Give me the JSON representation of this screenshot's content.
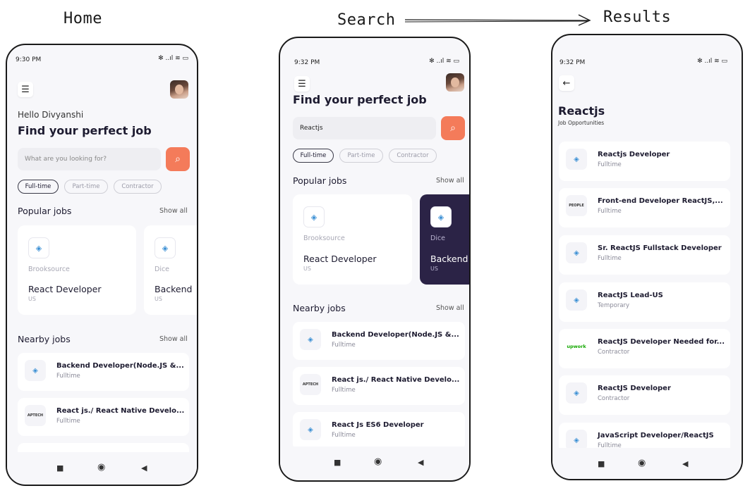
{
  "labels": {
    "home": "Home",
    "search": "Search",
    "results": "Results"
  },
  "status": {
    "home_time": "9:30 PM",
    "search_time": "9:32 PM",
    "results_time": "9:32 PM",
    "icons": "✻ ..ıl ≋ ▭"
  },
  "home": {
    "greeting": "Hello Divyanshi",
    "headline": "Find your perfect job",
    "search_placeholder": "What are you looking for?",
    "chips": [
      "Full-time",
      "Part-time",
      "Contractor"
    ],
    "popular_title": "Popular jobs",
    "nearby_title": "Nearby jobs",
    "show_all": "Show all",
    "popular": [
      {
        "company": "Brooksource",
        "title": "React Developer",
        "location": "US"
      },
      {
        "company": "Dice",
        "title": "Backend",
        "location": "US"
      }
    ],
    "nearby": [
      {
        "title": "Backend Developer(Node.JS &...",
        "type": "Fulltime",
        "logo": "◈"
      },
      {
        "title": "React js./ React Native Develo...",
        "type": "Fulltime",
        "logo": "APTECH"
      }
    ]
  },
  "search": {
    "headline": "Find your perfect job",
    "search_value": "Reactjs",
    "chips": [
      "Full-time",
      "Part-time",
      "Contractor"
    ],
    "popular_title": "Popular jobs",
    "nearby_title": "Nearby jobs",
    "show_all": "Show all",
    "popular": [
      {
        "company": "Brooksource",
        "title": "React Developer",
        "location": "US"
      },
      {
        "company": "Dice",
        "title": "Backend",
        "location": "US"
      }
    ],
    "nearby": [
      {
        "title": "Backend Developer(Node.JS &...",
        "type": "Fulltime",
        "logo": "◈"
      },
      {
        "title": "React js./ React Native Develo...",
        "type": "Fulltime",
        "logo": "APTECH"
      },
      {
        "title": "React Js ES6 Developer",
        "type": "Fulltime",
        "logo": "◈"
      }
    ]
  },
  "results": {
    "title": "Reactjs",
    "subtitle": "Job Opportunities",
    "items": [
      {
        "title": "Reactjs Developer",
        "type": "Fulltime",
        "logo": "◈"
      },
      {
        "title": "Front-end Developer ReactJS,...",
        "type": "Fulltime",
        "logo": "PEOPLE"
      },
      {
        "title": "Sr. ReactJS Fullstack Developer",
        "type": "Fulltime",
        "logo": "◈"
      },
      {
        "title": "ReactJS Lead-US",
        "type": "Temporary",
        "logo": "◈"
      },
      {
        "title": "ReactJS Developer Needed for...",
        "type": "Contractor",
        "logo": "upwork"
      },
      {
        "title": "ReactJS Developer",
        "type": "Contractor",
        "logo": "◈"
      },
      {
        "title": "JavaScript Developer/ReactJS",
        "type": "Fulltime",
        "logo": "◈"
      }
    ]
  },
  "icons": {
    "menu": "☰",
    "search": "⌕",
    "back": "←",
    "nav_square": "■",
    "nav_circle": "◉",
    "nav_back": "◀"
  },
  "colors": {
    "accent": "#f47b5a",
    "dark_card": "#2b2346",
    "upwork": "#14a800"
  }
}
